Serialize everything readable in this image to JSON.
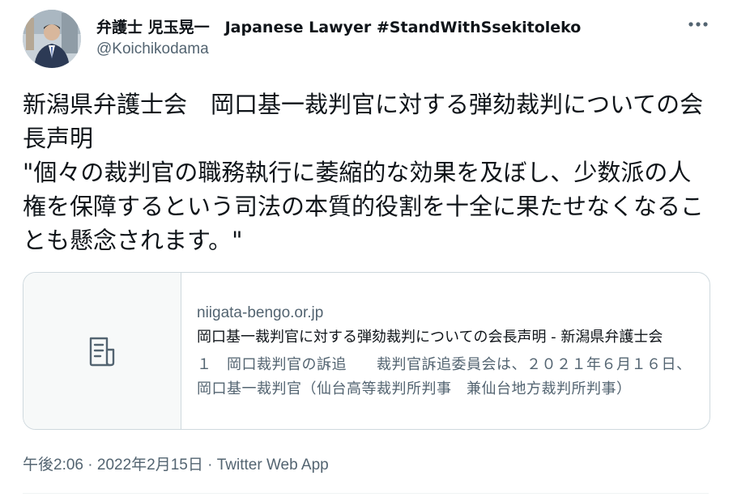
{
  "author": {
    "display_name": "弁護士 児玉晃一　Japanese Lawyer #StandWithSsekitoleko",
    "handle": "@Koichikodama"
  },
  "tweet": {
    "text": "新潟県弁護士会　岡口基一裁判官に対する弾劾裁判についての会長声明\n\"個々の裁判官の職務執行に萎縮的な効果を及ぼし、少数派の人権を保障するという司法の本質的役割を十全に果たせなくなることも懸念されます。\""
  },
  "card": {
    "domain": "niigata-bengo.or.jp",
    "title": "岡口基一裁判官に対する弾劾裁判についての会長声明 - 新潟県弁護士会",
    "description": "１　岡口裁判官の訴追　　裁判官訴追委員会は、２０２１年６月１６日、岡口基一裁判官（仙台高等裁判所判事　兼仙台地方裁判所判事）",
    "icon": "document-icon"
  },
  "meta": {
    "time": "午後2:06",
    "separator1": "·",
    "date": "2022年2月15日",
    "separator2": "·",
    "source": "Twitter Web App"
  },
  "colors": {
    "text": "#0f1419",
    "secondary": "#536471",
    "border": "#cfd9de",
    "thumb_bg": "#f7f9f9"
  }
}
